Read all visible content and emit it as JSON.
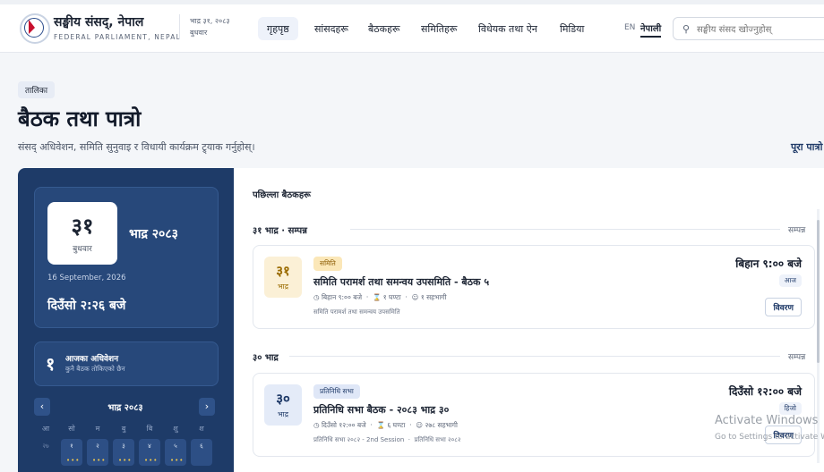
{
  "header": {
    "title": "सङ्घीय संसद्, नेपाल",
    "subtitle": "FEDERAL PARLIAMENT, NEPAL",
    "date_line1": "भाद्र ३१, २०८३",
    "date_line2": "बुधवार",
    "nav": [
      "गृहपृष्ठ",
      "सांसदहरू",
      "बैठकहरू",
      "समितिहरू",
      "विधेयक तथा ऐन",
      "मिडिया"
    ],
    "active_nav": "गृहपृष्ठ",
    "lang_en": "EN",
    "lang_np": "नेपाली",
    "search_placeholder": "सङ्घीय संसद खोज्नुहोस्"
  },
  "page": {
    "tag": "तालिका",
    "title": "बैठक तथा पात्रो",
    "subtitle": "संसद् अधिवेशन, समिति सुनुवाइ र विधायी कार्यक्रम ट्र्याक गर्नुहोस्।",
    "full_calendar_link": "पूरा पात्रो"
  },
  "sidebar": {
    "day_number": "३१",
    "weekday": "बुधवार",
    "month_year": "भाद्र २०८३",
    "english_date": "16 September, 2026",
    "clock": "दिउँसो २:२६ बजे",
    "sessions_count": "१",
    "sessions_title": "आजका अधिवेशन",
    "sessions_sub": "कुनै बैठक तोकिएको छैन",
    "calendar": {
      "month": "भाद्र २०८३",
      "prev": "‹",
      "next": "›",
      "weekdays": [
        "आ",
        "सो",
        "म",
        "बु",
        "बि",
        "शु",
        "श"
      ],
      "first_row": [
        "२७",
        "१",
        "२",
        "३",
        "४",
        "५",
        "६"
      ]
    }
  },
  "main": {
    "section_title": "पछिल्ला बैठकहरू",
    "groups": [
      {
        "label": "३१ भाद्र · सम्पन्न",
        "right": "सम्पन्न",
        "meeting": {
          "day": "३१",
          "month": "भाद्र",
          "category": "समिति",
          "title": "समिति परामर्श तथा समन्वय उपसमिति - बैठक ५",
          "time_meta": "बिहान ९:०० बजे",
          "duration": "१ घण्टा",
          "participants": "१ सहभागी",
          "body": "समिति परामर्श तथा समन्वय उपसमिति",
          "time": "बिहान ९:०० बजे",
          "when": "आज",
          "detail_label": "विवरण"
        }
      },
      {
        "label": "३० भाद्र",
        "right": "सम्पन्न",
        "meeting": {
          "day": "३०",
          "month": "भाद्र",
          "category": "प्रतिनिधि सभा",
          "title": "प्रतिनिधि सभा बैठक - २०८३ भाद्र ३०",
          "time_meta": "दिउँसो १२:०० बजे",
          "duration": "६ घण्टा",
          "participants": "२७८ सहभागी",
          "body": "प्रतिनिधि सभा २०८२ - 2nd Session",
          "body2": "प्रतिनिधि सभा २०८२",
          "time": "दिउँसो १२:०० बजे",
          "when": "हिजो",
          "detail_label": "विवरण"
        }
      }
    ]
  },
  "watermark": {
    "line1": "Activate Windows",
    "line2": "Go to Settings to activate Windows."
  },
  "colors": {
    "sidebar_bg": "#1e3b68",
    "committee_badge": "#fbe7b8",
    "house_badge": "#dfe7f7"
  }
}
